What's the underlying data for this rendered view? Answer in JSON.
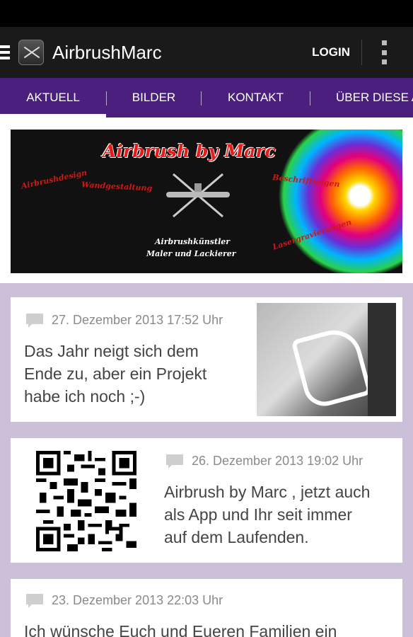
{
  "app": {
    "title": "AirbrushMarc",
    "login_label": "LOGIN"
  },
  "icons": {
    "drawer": "menu-icon",
    "app": "airbrush-app-icon",
    "overflow": "overflow-menu-icon",
    "comment": "comment-icon"
  },
  "tabs": [
    {
      "label": "AKTUELL",
      "active": true
    },
    {
      "label": "BILDER",
      "active": false
    },
    {
      "label": "KONTAKT",
      "active": false
    },
    {
      "label": "ÜBER DIESE A",
      "active": false
    }
  ],
  "banner": {
    "title": "Airbrush by Marc",
    "left_1": "Airbrushdesign",
    "left_2": "Wandgestaltung",
    "right_1": "Beschriftungen",
    "right_2": "Lasergravierungen",
    "center_1": "Airbrushkünstler",
    "center_2": "Maler und Lackierer"
  },
  "posts": [
    {
      "date": "27. Dezember 2013 17:52 Uhr",
      "text": [
        "Das Jahr neigt sich dem",
        "Ende zu, aber ein Projekt",
        "habe ich noch ;-)"
      ]
    },
    {
      "date": "26. Dezember 2013 19:02 Uhr",
      "text": [
        "Airbrush by Marc , jetzt auch",
        "als App und Ihr seit immer",
        "auf dem Laufenden."
      ]
    },
    {
      "date": "23. Dezember 2013 22:03 Uhr",
      "text": [
        "Ich wünsche Euch und Eueren Familien ein"
      ]
    }
  ],
  "colors": {
    "tab_bar": "#4b1f7e",
    "background": "#ccc0d9",
    "action_bar": "#1a1a1a"
  }
}
